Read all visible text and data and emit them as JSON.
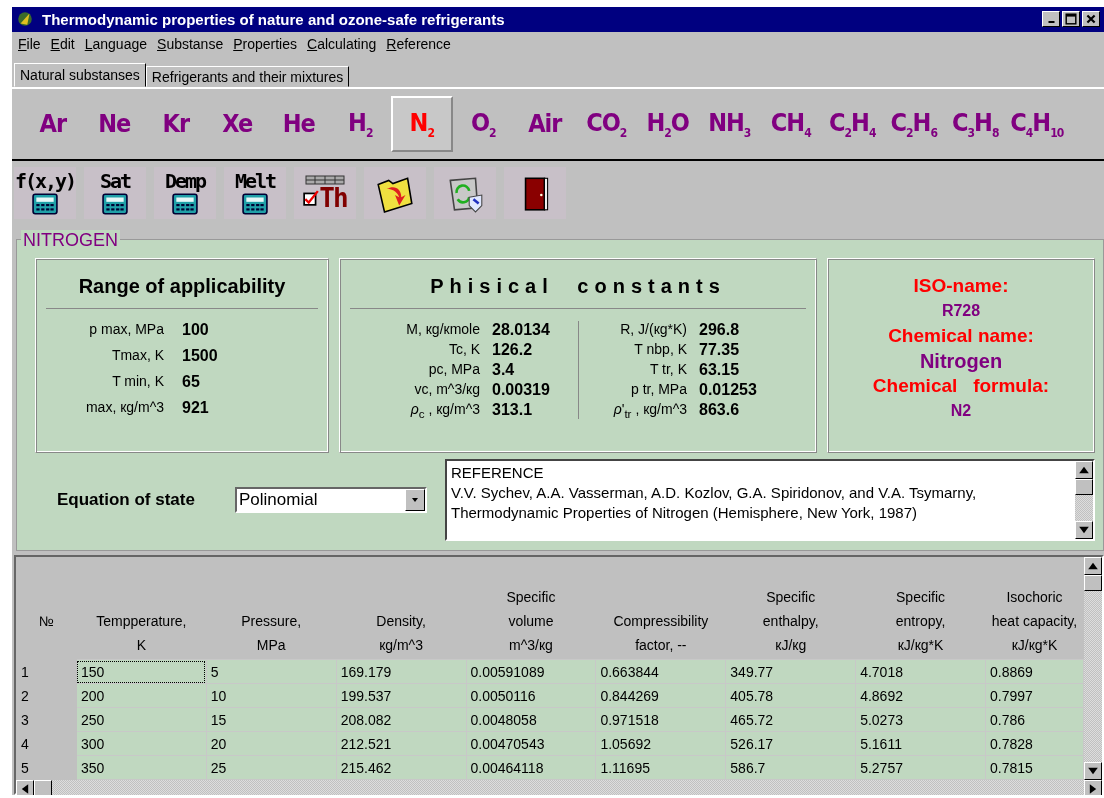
{
  "window": {
    "title": "Thermodynamic properties of nature and ozone-safe refrigerants"
  },
  "menu": [
    "File",
    "Edit",
    "Language",
    "Substanse",
    "Properties",
    "Calculating",
    "Reference"
  ],
  "tabs": [
    {
      "label": "Natural substanses",
      "selected": true
    },
    {
      "label": "Refrigerants and their mixtures",
      "selected": false
    }
  ],
  "substances": [
    {
      "label": "Ar",
      "selected": false
    },
    {
      "label": "Ne",
      "selected": false
    },
    {
      "label": "Kr",
      "selected": false
    },
    {
      "label": "Xe",
      "selected": false
    },
    {
      "label": "He",
      "selected": false
    },
    {
      "label": "H$_{2}$",
      "selected": false
    },
    {
      "label": "N$_{2}$",
      "selected": true
    },
    {
      "label": "O$_{2}$",
      "selected": false
    },
    {
      "label": "Air",
      "selected": false
    },
    {
      "label": "CO$_{2}$",
      "selected": false
    },
    {
      "label": "H$_{2}$O",
      "selected": false
    },
    {
      "label": "NH$_{3}$",
      "selected": false
    },
    {
      "label": "CH$_{4}$",
      "selected": false
    },
    {
      "label": "C$_{2}$H$_{4}$",
      "selected": false
    },
    {
      "label": "C$_{2}$H$_{6}$",
      "selected": false
    },
    {
      "label": "C$_{3}$H$_{8}$",
      "selected": false
    },
    {
      "label": "C$_{4}$H$_{10}$",
      "selected": false
    }
  ],
  "tools": [
    {
      "kind": "calc",
      "label": "f(x,y)"
    },
    {
      "kind": "calc",
      "label": "Sat"
    },
    {
      "kind": "calc",
      "label": "Demp"
    },
    {
      "kind": "calc",
      "label": "Melt"
    },
    {
      "kind": "table",
      "label": "Th"
    },
    {
      "kind": "folder"
    },
    {
      "kind": "recycle"
    },
    {
      "kind": "door"
    }
  ],
  "group": {
    "title": "NITROGEN",
    "range": {
      "title": "Range of applicability",
      "rows": [
        {
          "label": "p max, MPa",
          "value": "100"
        },
        {
          "label": "Tmax, K",
          "value": "1500"
        },
        {
          "label": "T min,  K",
          "value": "65"
        },
        {
          "label": "max, кg/m^3",
          "value": "921"
        }
      ]
    },
    "constants": {
      "title": "Phisical constants",
      "left": [
        {
          "label": "M, кg/кmole",
          "value": "28.0134"
        },
        {
          "label": "Tc, K",
          "value": "126.2"
        },
        {
          "label": "pc, MPa",
          "value": "3.4"
        },
        {
          "label": "vc, m^3/кg",
          "value": "0.00319"
        },
        {
          "label": "*ρ*$_{c}$ , кg/m^3",
          "value": "313.1"
        }
      ],
      "right": [
        {
          "label": "R, J/(кg*K)",
          "value": "296.8"
        },
        {
          "label": "T nbp, K",
          "value": "77.35"
        },
        {
          "label": "T tr, K",
          "value": "63.15"
        },
        {
          "label": "p tr, MPa",
          "value": "0.01253"
        },
        {
          "label": "*ρ*'$_{tr}$ , кg/m^3",
          "value": "863.6"
        }
      ]
    },
    "identity": [
      {
        "label": "ISO-name:",
        "value": "R728"
      },
      {
        "label": "Chemical name:",
        "value": "Nitrogen"
      },
      {
        "label": "Chemical   formula:",
        "value": "N2"
      }
    ],
    "equation": {
      "label": "Equation of state",
      "value": "Polinomial"
    },
    "reference": [
      "REFERENCE",
      "V.V. Sychev, A.A. Vasserman, A.D. Kozlov, G.A. Spiridonov, and V.A. Tsymarny,",
      "Thermodynamic Properties of Nitrogen (Hemisphere, New York, 1987)"
    ]
  },
  "table": {
    "columns": [
      "№",
      "Tempperature,\nK",
      "Pressure,\nMPa",
      "Density,\nкg/m^3",
      "Specific\nvolume\nm^3/кg",
      "Compressibility\nfactor, --",
      "Specific\nenthalpy,\nкJ/кg",
      "Specific\nentropy,\nкJ/кg*K",
      "Isochoric\nheat capacity,\nкJ/кg*K"
    ],
    "rows": [
      {
        "focused": true,
        "cells": [
          "1",
          "150",
          "5",
          "169.179",
          "0.00591089",
          "0.663844",
          "349.77",
          "4.7018",
          "0.8869"
        ]
      },
      {
        "focused": false,
        "cells": [
          "2",
          "200",
          "10",
          "199.537",
          "0.0050116",
          "0.844269",
          "405.78",
          "4.8692",
          "0.7997"
        ]
      },
      {
        "focused": false,
        "cells": [
          "3",
          "250",
          "15",
          "208.082",
          "0.0048058",
          "0.971518",
          "465.72",
          "5.0273",
          "0.786"
        ]
      },
      {
        "focused": false,
        "cells": [
          "4",
          "300",
          "20",
          "212.521",
          "0.00470543",
          "1.05692",
          "526.17",
          "5.1611",
          "0.7828"
        ]
      },
      {
        "focused": false,
        "cells": [
          "5",
          "350",
          "25",
          "215.462",
          "0.00464118",
          "1.11695",
          "586.7",
          "5.2757",
          "0.7815"
        ]
      }
    ]
  }
}
